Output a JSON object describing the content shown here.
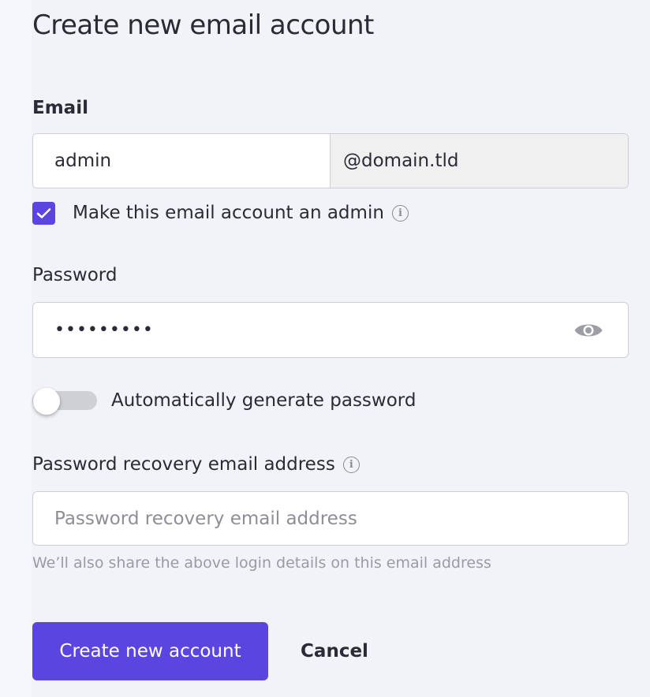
{
  "page": {
    "title": "Create new email account"
  },
  "email": {
    "label": "Email",
    "local_value": "admin",
    "domain_suffix": "@domain.tld"
  },
  "admin_option": {
    "label": "Make this email account an admin",
    "checked": true,
    "info_icon": "info-icon"
  },
  "password": {
    "label": "Password",
    "masked_value": "•••••••••",
    "visibility_icon": "eye-icon"
  },
  "auto_generate": {
    "label": "Automatically generate password",
    "enabled": false
  },
  "recovery": {
    "label": "Password recovery email address",
    "placeholder": "Password recovery email address",
    "value": "",
    "hint": "We’ll also share the above login details on this email address",
    "info_icon": "info-icon"
  },
  "actions": {
    "primary_label": "Create new account",
    "cancel_label": "Cancel"
  },
  "colors": {
    "accent": "#5b45e0",
    "background": "#f2f3f8",
    "border": "#cfd0d6"
  }
}
